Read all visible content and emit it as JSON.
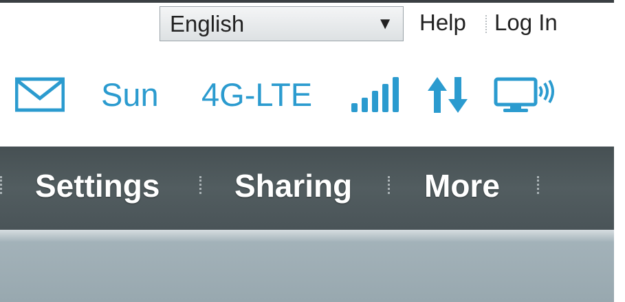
{
  "header": {
    "language": {
      "selected": "English",
      "arrow_glyph": "▼"
    },
    "help_label": "Help",
    "login_label": "Log In"
  },
  "status": {
    "carrier": "Sun",
    "network": "4G-LTE",
    "signal_bars": 5,
    "icons": [
      "mail-icon",
      "signal-icon",
      "data-transfer-icon",
      "connected-device-icon"
    ],
    "accent_color": "#2b9bcf"
  },
  "nav": {
    "items": [
      {
        "label": "Settings"
      },
      {
        "label": "Sharing"
      },
      {
        "label": "More"
      }
    ],
    "background_color": "#4e585b"
  }
}
